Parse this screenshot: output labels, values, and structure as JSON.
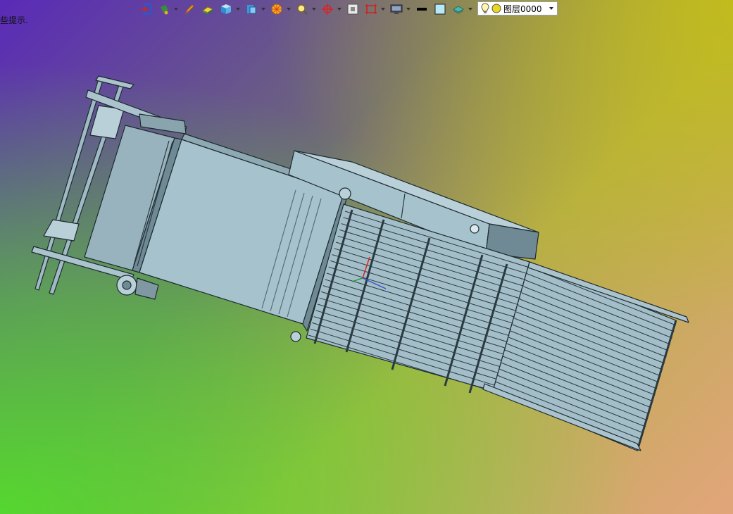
{
  "status": {
    "hint": "些提示."
  },
  "toolbar": {
    "buttons": [
      {
        "icon": "exit-sketch-icon",
        "dropdown": false
      },
      {
        "icon": "paint-can-icon",
        "dropdown": true
      },
      {
        "icon": "pencil-icon",
        "dropdown": false
      },
      {
        "icon": "eraser-icon",
        "dropdown": false
      },
      {
        "icon": "view-cube-icon",
        "dropdown": true
      },
      {
        "icon": "section-view-icon",
        "dropdown": true
      },
      {
        "icon": "appearance-wheel-icon",
        "dropdown": true
      },
      {
        "icon": "zoom-fit-icon",
        "dropdown": true
      },
      {
        "icon": "rotate-axis-icon",
        "dropdown": true
      },
      {
        "icon": "zoom-area-icon",
        "dropdown": false
      },
      {
        "icon": "display-style-icon",
        "dropdown": true
      },
      {
        "icon": "monitor-icon",
        "dropdown": true
      },
      {
        "icon": "line-thickness-icon",
        "dropdown": false
      },
      {
        "icon": "fill-color-icon",
        "dropdown": false
      },
      {
        "icon": "layer-stack-icon",
        "dropdown": true
      }
    ]
  },
  "layer": {
    "name": "图层0000",
    "colors": {
      "bulb": "#f5e050",
      "dot": "#e8d820"
    }
  },
  "colors": {
    "model_fill": "#a6c2cc",
    "model_dark": "#6f8a94",
    "model_line": "#1d2a30"
  }
}
